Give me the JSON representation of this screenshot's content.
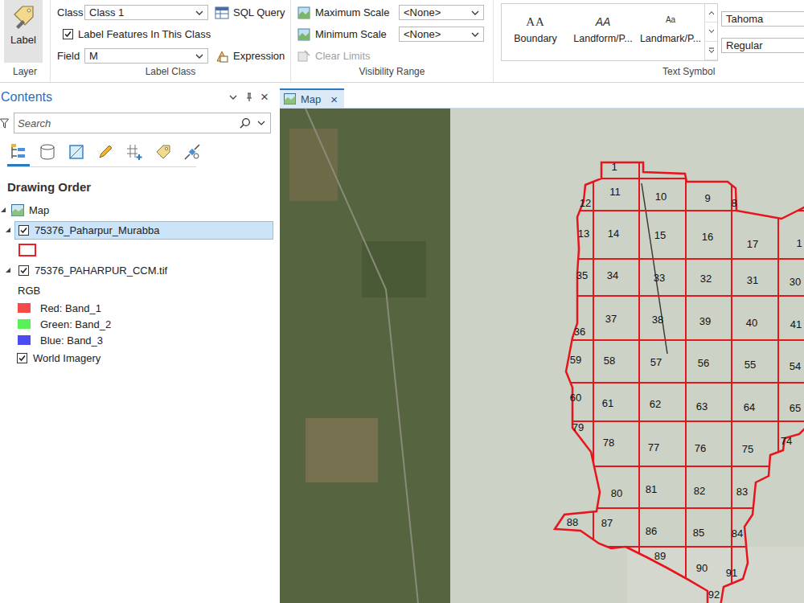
{
  "ribbon": {
    "layer_group": {
      "button": "Label",
      "label": "Layer"
    },
    "label_class": {
      "class_label": "Class",
      "class_value": "Class 1",
      "sql_button": "SQL Query",
      "checkbox": {
        "label": "Label Features In This Class",
        "checked": true
      },
      "field_label": "Field",
      "field_value": "M",
      "expression_button": "Expression",
      "label": "Label Class"
    },
    "visibility": {
      "rows": [
        {
          "label": "Maximum Scale",
          "value": "<None>"
        },
        {
          "label": "Minimum Scale",
          "value": "<None>"
        }
      ],
      "clear": {
        "label": "Clear Limits",
        "disabled": true
      },
      "label": "Visibility Range"
    },
    "text_symbol": {
      "gallery": [
        {
          "kind": "serif",
          "glyph": "AA",
          "label": "Boundary"
        },
        {
          "kind": "italic",
          "glyph": "AA",
          "label": "Landform/P..."
        },
        {
          "kind": "small",
          "glyph": "Aa",
          "label": "Landmark/P..."
        }
      ],
      "font": "Tahoma",
      "style": "Regular",
      "label": "Text Symbol"
    }
  },
  "contents": {
    "title": "Contents",
    "close": "×",
    "search": {
      "placeholder": "Search"
    },
    "view_tabs": [
      {
        "kind": "drawing-order",
        "selected": true
      },
      {
        "kind": "data-source",
        "selected": false
      },
      {
        "kind": "selection",
        "selected": false
      },
      {
        "kind": "editing",
        "selected": false
      },
      {
        "kind": "snapping",
        "selected": false
      },
      {
        "kind": "labeling",
        "selected": false
      },
      {
        "kind": "perspective",
        "selected": false
      }
    ],
    "heading": "Drawing Order",
    "tree": [
      {
        "kind": "map",
        "label": "Map",
        "expanded": true
      },
      {
        "kind": "layer",
        "label": "75376_Paharpur_Murabba",
        "checked": true,
        "expanded": true,
        "selected": true
      },
      {
        "kind": "symbol",
        "color": "#e8202a"
      },
      {
        "kind": "layer",
        "label": "75376_PAHARPUR_CCM.tif",
        "checked": true,
        "expanded": true,
        "selected": false
      },
      {
        "kind": "legend-heading",
        "label": "RGB"
      },
      {
        "kind": "band",
        "label": "Red: Band_1",
        "color": "#f44a4a"
      },
      {
        "kind": "band",
        "label": "Green: Band_2",
        "color": "#5af05a"
      },
      {
        "kind": "band",
        "label": "Blue: Band_3",
        "color": "#4b4bf0"
      },
      {
        "kind": "basemap",
        "label": "World Imagery",
        "checked": true
      }
    ]
  },
  "map": {
    "tab": {
      "label": "Map",
      "close": "×",
      "selected": true
    },
    "parcels": [
      "1",
      "11",
      "10",
      "9",
      "8",
      "12",
      "13",
      "14",
      "15",
      "16",
      "17",
      "1",
      "35",
      "34",
      "33",
      "32",
      "31",
      "30",
      "37",
      "38",
      "39",
      "40",
      "41",
      "36",
      "59",
      "58",
      "57",
      "56",
      "55",
      "54",
      "60",
      "61",
      "62",
      "63",
      "64",
      "65",
      "79",
      "78",
      "77",
      "76",
      "75",
      "74",
      "80",
      "81",
      "82",
      "83",
      "88",
      "87",
      "86",
      "85",
      "84",
      "89",
      "90",
      "91",
      "92"
    ]
  }
}
